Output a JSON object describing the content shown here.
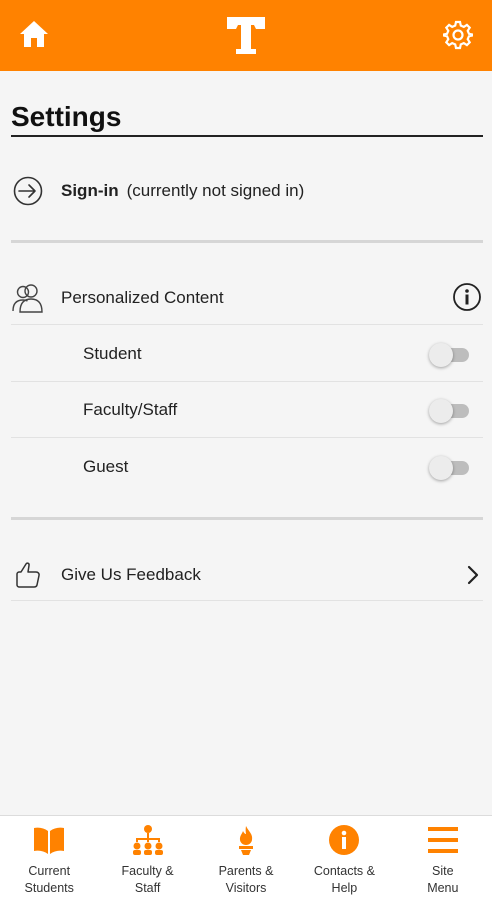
{
  "colors": {
    "brand": "#ff8200",
    "background": "#f5f5f5"
  },
  "header": {
    "home_icon": "home-icon",
    "logo_icon": "power-t-logo",
    "settings_icon": "gear-icon"
  },
  "page": {
    "title": "Settings"
  },
  "signin": {
    "icon": "sign-in-icon",
    "label": "Sign-in",
    "status": "(currently not signed in)"
  },
  "personalized": {
    "icon": "users-icon",
    "label": "Personalized Content",
    "info_icon": "info-icon",
    "options": [
      {
        "label": "Student",
        "enabled": false
      },
      {
        "label": "Faculty/Staff",
        "enabled": false
      },
      {
        "label": "Guest",
        "enabled": false
      }
    ]
  },
  "feedback": {
    "icon": "thumbs-up-icon",
    "label": "Give Us Feedback",
    "chevron_icon": "chevron-right-icon"
  },
  "bottom_nav": [
    {
      "icon": "book-icon",
      "label": "Current\nStudents"
    },
    {
      "icon": "org-chart-icon",
      "label": "Faculty &\nStaff"
    },
    {
      "icon": "torch-icon",
      "label": "Parents &\nVisitors"
    },
    {
      "icon": "info-circle-icon",
      "label": "Contacts &\nHelp"
    },
    {
      "icon": "menu-icon",
      "label": "Site\nMenu"
    }
  ]
}
